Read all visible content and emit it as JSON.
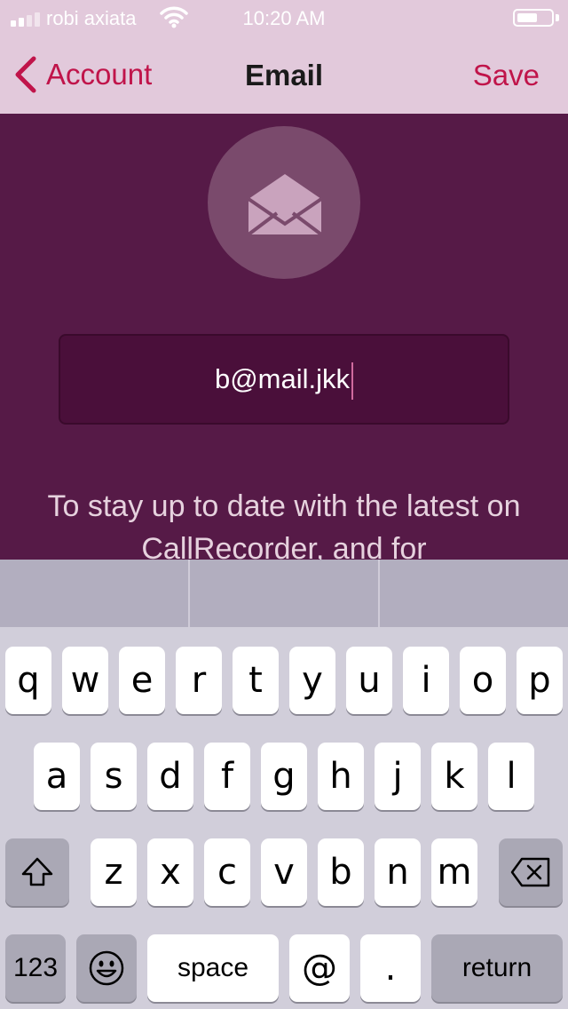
{
  "status_bar": {
    "carrier": "robi axiata",
    "time": "10:20 AM",
    "battery_level": 0.6
  },
  "nav": {
    "back_label": "Account",
    "title": "Email",
    "save_label": "Save"
  },
  "email": {
    "value": "b@mail.jkk"
  },
  "info_text": "To stay up to date with the latest on CallRecorder, and for",
  "keyboard": {
    "row1": [
      "q",
      "w",
      "e",
      "r",
      "t",
      "y",
      "u",
      "i",
      "o",
      "p"
    ],
    "row2": [
      "a",
      "s",
      "d",
      "f",
      "g",
      "h",
      "j",
      "k",
      "l"
    ],
    "row3": [
      "z",
      "x",
      "c",
      "v",
      "b",
      "n",
      "m"
    ],
    "numbers_label": "123",
    "space_label": "space",
    "at_label": "@",
    "dot_label": ".",
    "return_label": "return"
  },
  "colors": {
    "accent": "#c0144a",
    "header_bg": "#e2c9db",
    "content_bg": "#561a47"
  }
}
